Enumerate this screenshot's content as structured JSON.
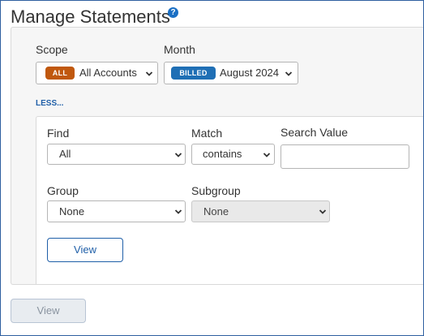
{
  "header": {
    "title": "Manage Statements",
    "help_icon": "help-icon",
    "help_glyph": "?"
  },
  "scope": {
    "label": "Scope",
    "badge": "ALL",
    "badge_color": "#c0580e",
    "value": "All Accounts"
  },
  "month": {
    "label": "Month",
    "badge": "BILLED",
    "badge_color": "#1f6fb5",
    "value": "August 2024"
  },
  "less_link": "LESS...",
  "filters": {
    "find": {
      "label": "Find",
      "value": "All"
    },
    "match": {
      "label": "Match",
      "value": "contains"
    },
    "search": {
      "label": "Search Value",
      "value": ""
    },
    "group": {
      "label": "Group",
      "value": "None"
    },
    "subgroup": {
      "label": "Subgroup",
      "value": "None",
      "disabled": true
    },
    "view_button": "View"
  },
  "footer": {
    "view_button": "View",
    "view_button_disabled": true
  },
  "colors": {
    "accent": "#1f5fa8",
    "border": "#2f5fa0"
  }
}
